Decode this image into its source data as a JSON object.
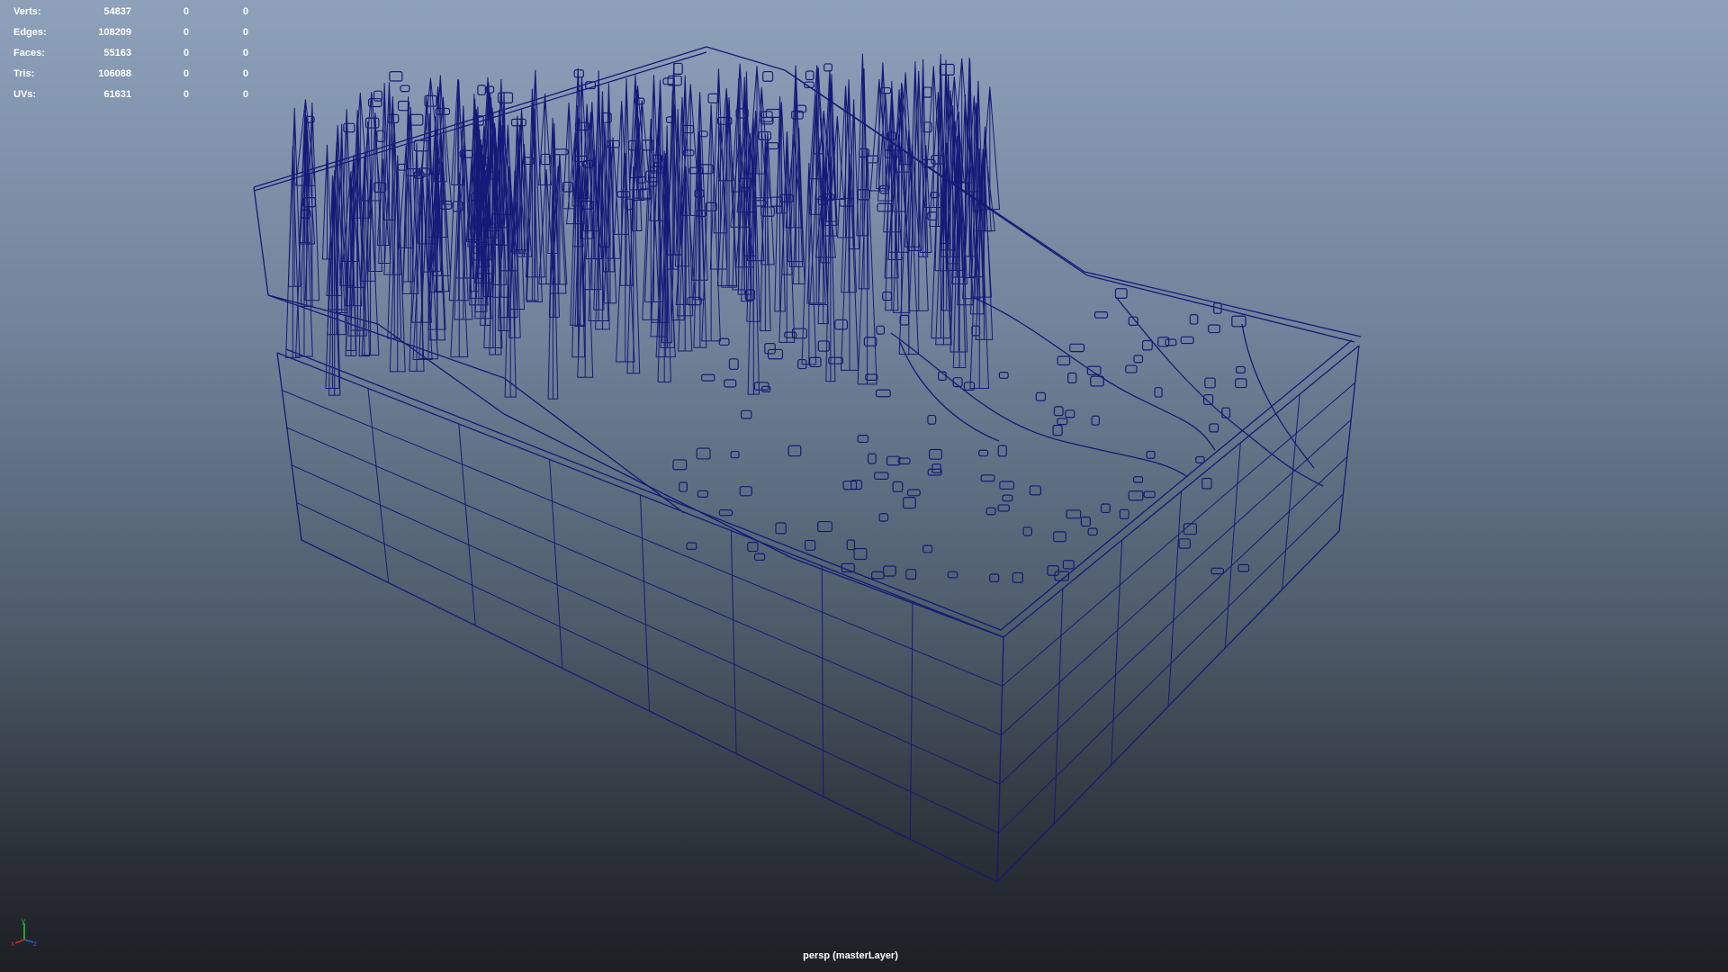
{
  "hud": {
    "rows": [
      {
        "label": "Verts:",
        "value": "54837",
        "selected": "0",
        "uv": "0"
      },
      {
        "label": "Edges:",
        "value": "108209",
        "selected": "0",
        "uv": "0"
      },
      {
        "label": "Faces:",
        "value": "55163",
        "selected": "0",
        "uv": "0"
      },
      {
        "label": "Tris:",
        "value": "106088",
        "selected": "0",
        "uv": "0"
      },
      {
        "label": "UVs:",
        "value": "61631",
        "selected": "0",
        "uv": "0"
      }
    ]
  },
  "viewport": {
    "camera_label": "persp (masterLayer)",
    "wireframe_color": "#141a78",
    "display_mode": "wireframe"
  },
  "axis_gizmo": {
    "x_label": "x",
    "y_label": "y",
    "z_label": "z",
    "x_color": "#d02a2a",
    "y_color": "#2ac43c",
    "z_color": "#2a5ad0"
  }
}
